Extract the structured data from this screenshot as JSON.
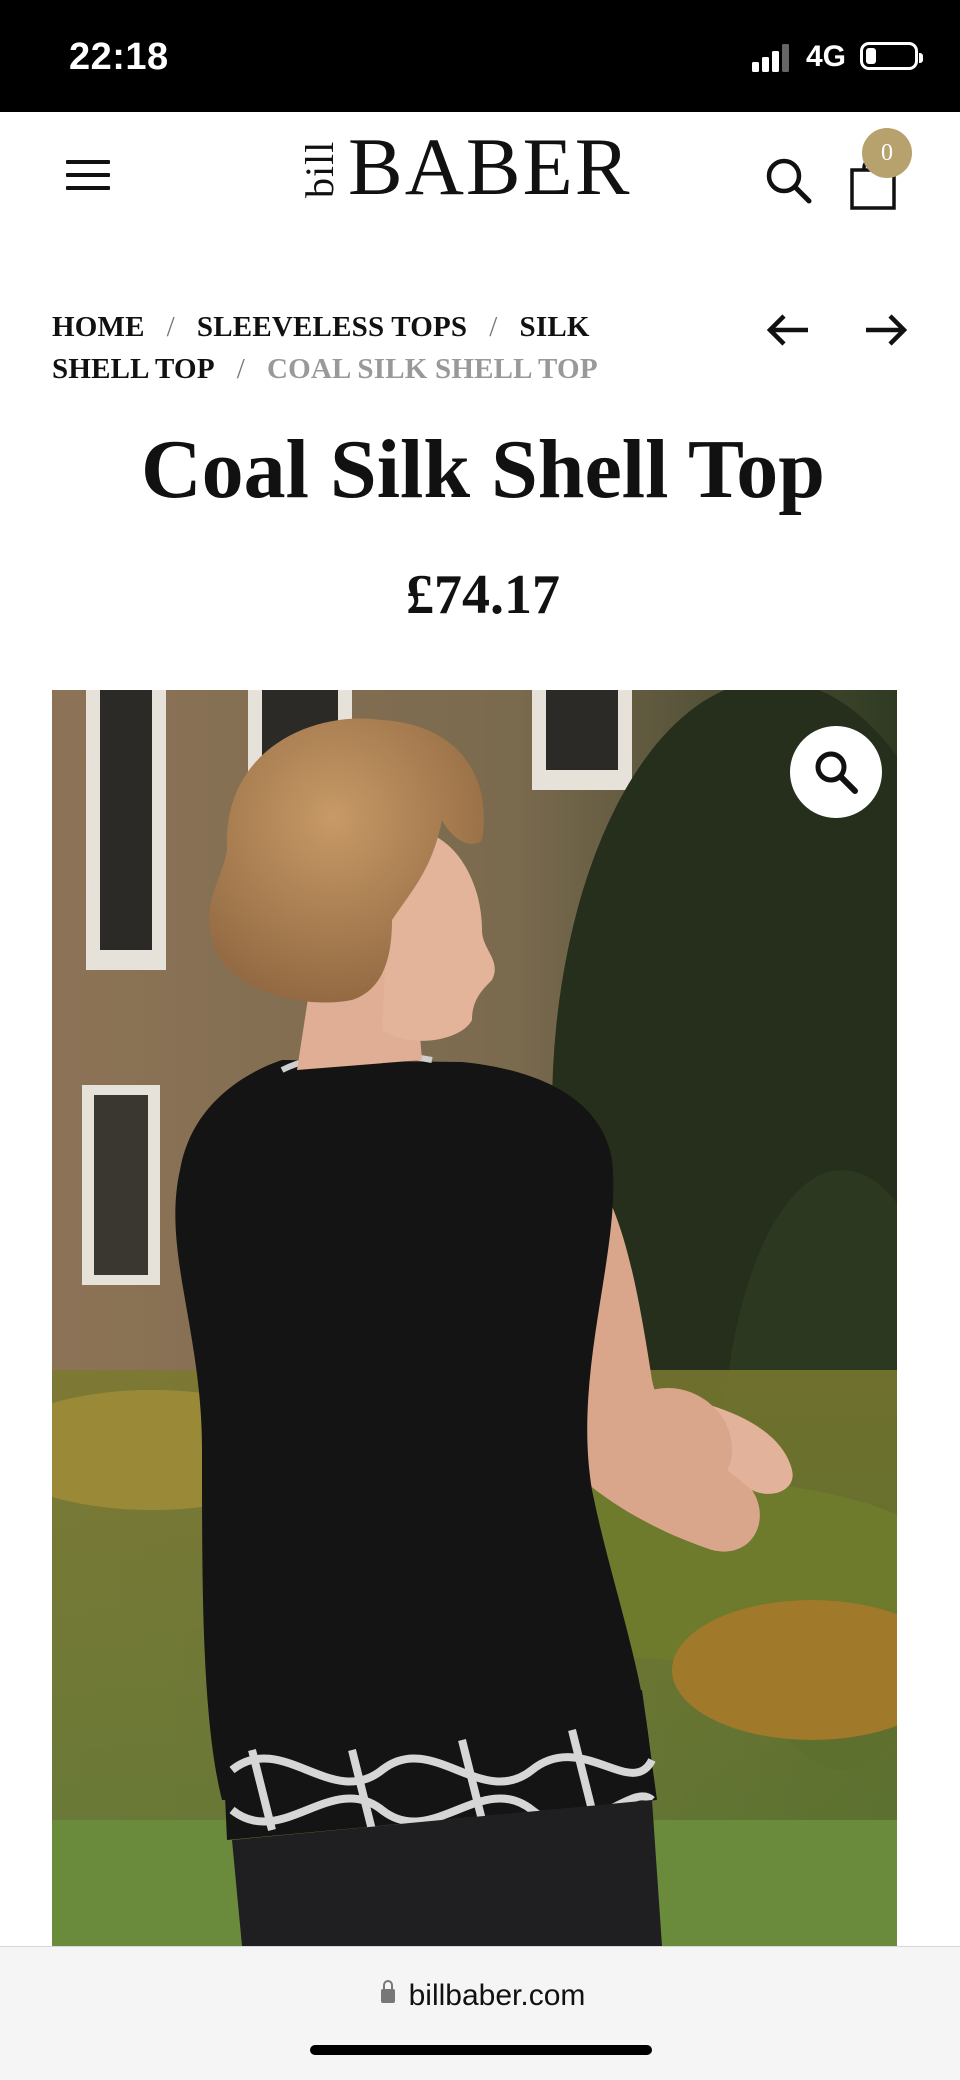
{
  "status_bar": {
    "time": "22:18",
    "network": "4G",
    "battery_level": 0.2
  },
  "header": {
    "logo_small": "bill",
    "logo_big": "BABER",
    "cart_count": "0"
  },
  "breadcrumb": [
    {
      "label": "HOME"
    },
    {
      "label": "SLEEVELESS TOPS"
    },
    {
      "label": "SILK SHELL TOP"
    },
    {
      "label": "COAL SILK SHELL TOP"
    }
  ],
  "product": {
    "title": "Coal Silk Shell Top",
    "price": "£74.17"
  },
  "browser": {
    "url": "billbaber.com"
  },
  "colors": {
    "cart_badge": "#b7a16c",
    "status_bar": "#000000"
  }
}
